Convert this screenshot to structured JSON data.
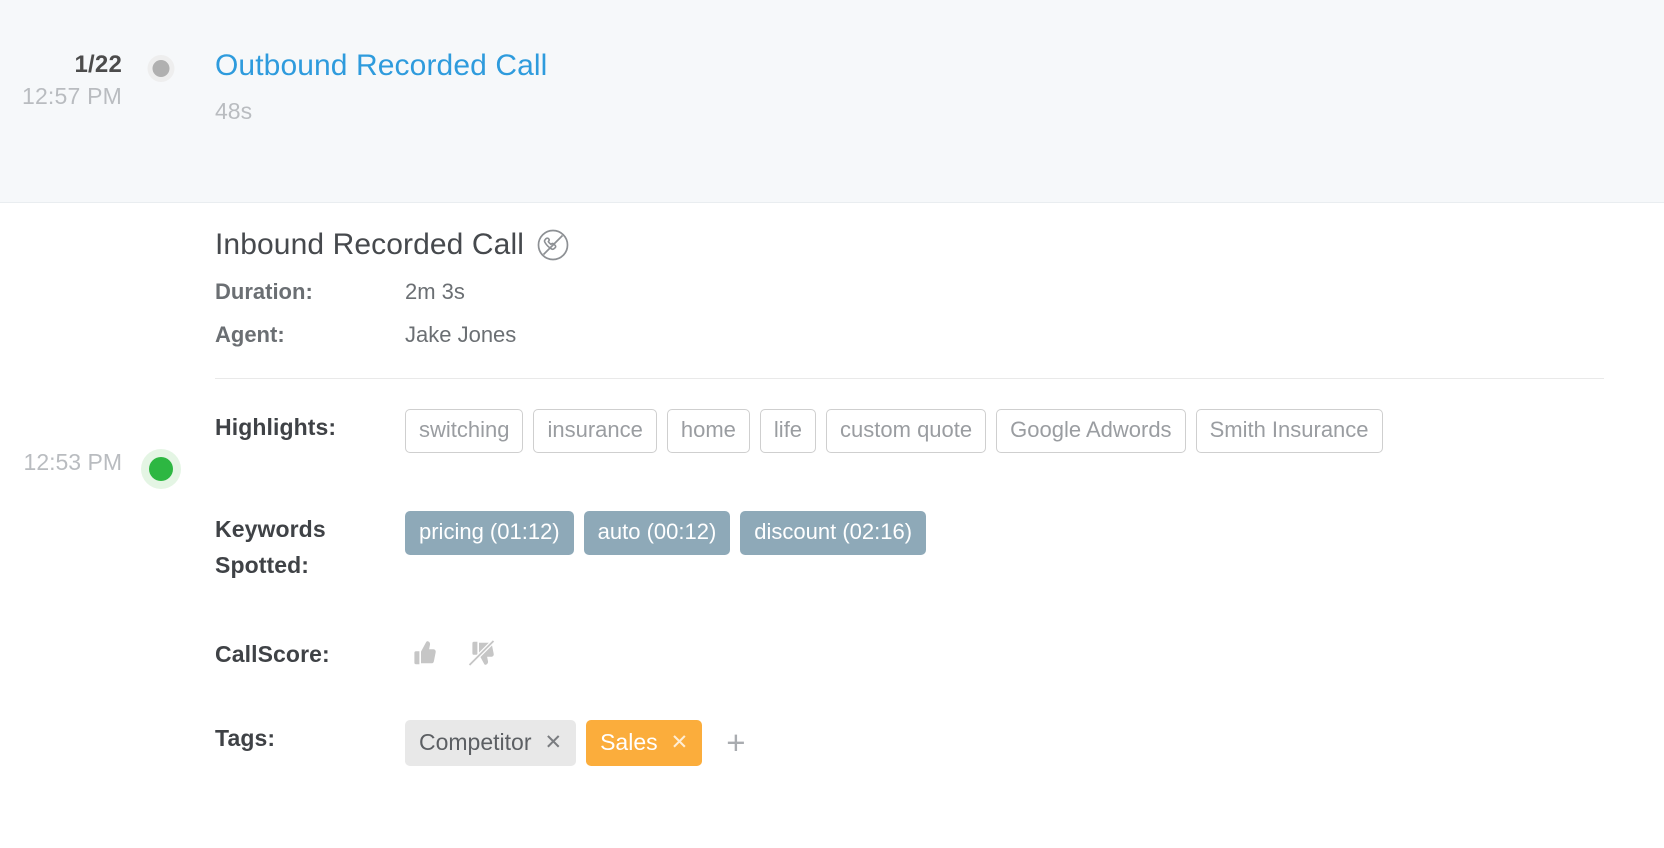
{
  "timeline": {
    "entries": [
      {
        "date": "1/22",
        "time": "12:57 PM",
        "title": "Outbound Recorded Call",
        "duration_sub": "48s",
        "dot": "gray-dot"
      },
      {
        "time": "12:53 PM",
        "title": "Inbound Recorded Call",
        "dot": "green-dot",
        "blocked_icon": "do-not-call-icon",
        "meta": [
          {
            "label": "Duration:",
            "value": "2m 3s"
          },
          {
            "label": "Agent:",
            "value": "Jake Jones"
          }
        ],
        "highlights": {
          "label": "Highlights:",
          "items": [
            "switching",
            "insurance",
            "home",
            "life",
            "custom quote",
            "Google Adwords",
            "Smith Insurance"
          ]
        },
        "keywords": {
          "label": "Keywords Spotted:",
          "items": [
            "pricing (01:12)",
            "auto (00:12)",
            "discount (02:16)"
          ]
        },
        "callscore": {
          "label": "CallScore:",
          "thumbs_up_icon": "thumbs-up-icon",
          "thumbs_down_icon": "thumbs-down-slashed-icon"
        },
        "tags": {
          "label": "Tags:",
          "items": [
            {
              "name": "Competitor",
              "style": "gray",
              "remove_icon": "close-icon"
            },
            {
              "name": "Sales",
              "style": "orange",
              "remove_icon": "close-icon"
            }
          ],
          "add_label": "+"
        }
      }
    ]
  },
  "colors": {
    "link": "#2e9bdd",
    "green_dot": "#2db742",
    "rail_green": "#c6e8c6",
    "rail_gray": "#e3e3e3",
    "keyword_chip": "#8ea9b8",
    "tag_orange": "#fbad3c",
    "tag_gray": "#e8e8e8"
  }
}
